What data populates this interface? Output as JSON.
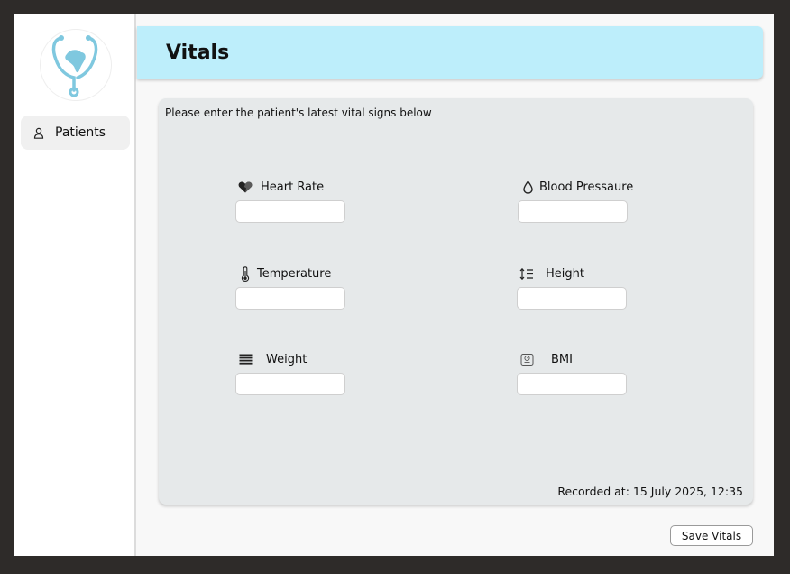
{
  "sidebar": {
    "items": [
      {
        "label": "Patients",
        "icon": "person-icon"
      }
    ]
  },
  "header": {
    "title": "Vitals"
  },
  "form": {
    "intro": "Please enter the patient's latest vital signs below",
    "fields": [
      {
        "label": "Heart Rate",
        "icon": "heart-icon",
        "value": ""
      },
      {
        "label": "Blood Pressaure",
        "icon": "droplet-icon",
        "value": ""
      },
      {
        "label": "Temperature",
        "icon": "thermometer-icon",
        "value": ""
      },
      {
        "label": "Height",
        "icon": "height-list-icon",
        "value": ""
      },
      {
        "label": "Weight",
        "icon": "weight-lines-icon",
        "value": ""
      },
      {
        "label": "BMI",
        "icon": "scale-icon",
        "value": ""
      }
    ],
    "recorded_at": "Recorded at: 15 July 2025, 12:35"
  },
  "actions": {
    "save_label": "Save Vitals"
  },
  "colors": {
    "header_bg": "#bdeefb",
    "card_bg": "#e6e9ea",
    "logo_accent": "#7fc8df"
  }
}
